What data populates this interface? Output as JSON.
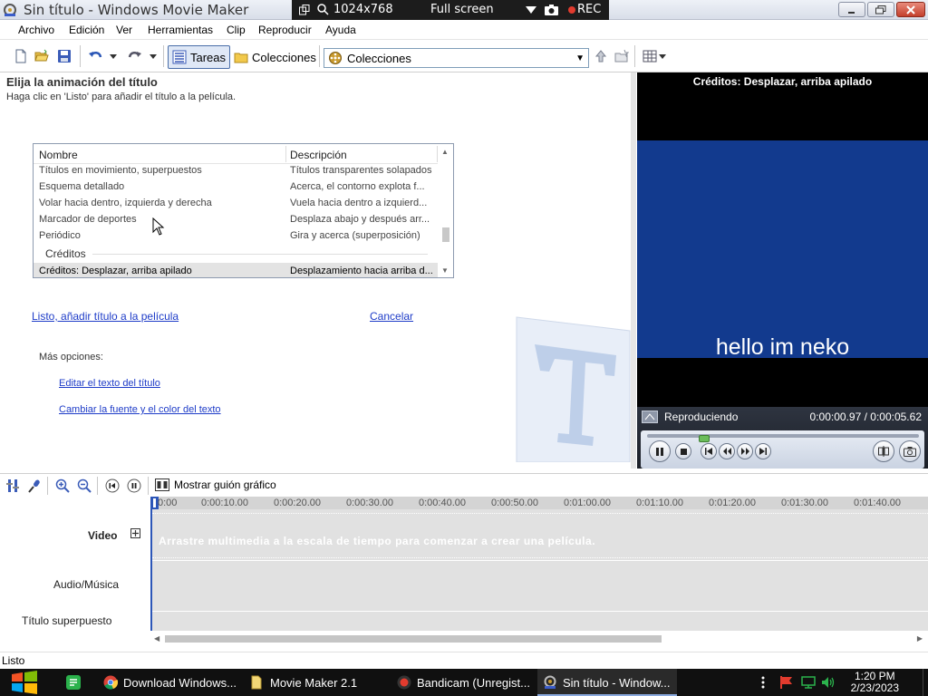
{
  "window": {
    "title": "Sin título - Windows Movie Maker"
  },
  "recorder": {
    "resolution": "1024x768",
    "mode": "Full screen",
    "rec_label": "REC"
  },
  "menu": [
    "Archivo",
    "Edición",
    "Ver",
    "Herramientas",
    "Clip",
    "Reproducir",
    "Ayuda"
  ],
  "toolbar": {
    "tasks_label": "Tareas",
    "collections_label": "Colecciones",
    "collections_combo_value": "Colecciones"
  },
  "task_pane": {
    "title": "Elija la animación del título",
    "subtitle": "Haga clic en 'Listo' para añadir el título a la película.",
    "list": {
      "columns": [
        "Nombre",
        "Descripción"
      ],
      "rows": [
        {
          "name": "Títulos en movimiento, superpuestos",
          "desc": "Títulos transparentes solapados"
        },
        {
          "name": "Esquema detallado",
          "desc": "Acerca, el contorno explota f..."
        },
        {
          "name": "Volar hacia dentro, izquierda y derecha",
          "desc": "Vuela hacia dentro a izquierd..."
        },
        {
          "name": "Marcador de deportes",
          "desc": "Desplaza abajo y después arr..."
        },
        {
          "name": "Periódico",
          "desc": "Gira y acerca (superposición)"
        }
      ],
      "group_label": "Créditos",
      "selected_row": {
        "name": "Créditos: Desplazar, arriba apilado",
        "desc": "Desplazamiento hacia arriba d..."
      }
    },
    "done_link": "Listo, añadir título a la película",
    "cancel_link": "Cancelar",
    "more_options_label": "Más opciones:",
    "edit_text_link": "Editar el texto del título",
    "change_font_link": "Cambiar la fuente y el color del texto"
  },
  "preview": {
    "title": "Créditos: Desplazar, arriba apilado",
    "video_text": "hello im neko",
    "status": "Reproduciendo",
    "time": "0:00:00.97 / 0:00:05.62",
    "playback_fraction": 0.17
  },
  "timeline": {
    "storyboard_label": "Mostrar guión gráfico",
    "ruler_ticks": [
      "0:00",
      "0:00:10.00",
      "0:00:20.00",
      "0:00:30.00",
      "0:00:40.00",
      "0:00:50.00",
      "0:01:00.00",
      "0:01:10.00",
      "0:01:20.00",
      "0:01:30.00",
      "0:01:40.00"
    ],
    "video_track_label": "Video",
    "video_track_message": "Arrastre multimedia a la escala de tiempo para comenzar a crear una película.",
    "audio_track_label": "Audio/Música",
    "title_track_label": "Título superpuesto"
  },
  "status_bar": {
    "text": "Listo"
  },
  "taskbar": {
    "tasks": [
      {
        "label": "Download Windows...",
        "icon": "chrome-icon"
      },
      {
        "label": "Movie Maker 2.1",
        "icon": "folder-icon"
      },
      {
        "label": "Bandicam (Unregist...",
        "icon": "bandicam-icon"
      },
      {
        "label": "Sin título - Window...",
        "icon": "movie-maker-icon"
      }
    ],
    "time": "1:20 PM",
    "date": "2/23/2023"
  },
  "colors": {
    "video_background": "#123a8e",
    "link": "#1e3cc8",
    "taskbar": "#101010"
  }
}
